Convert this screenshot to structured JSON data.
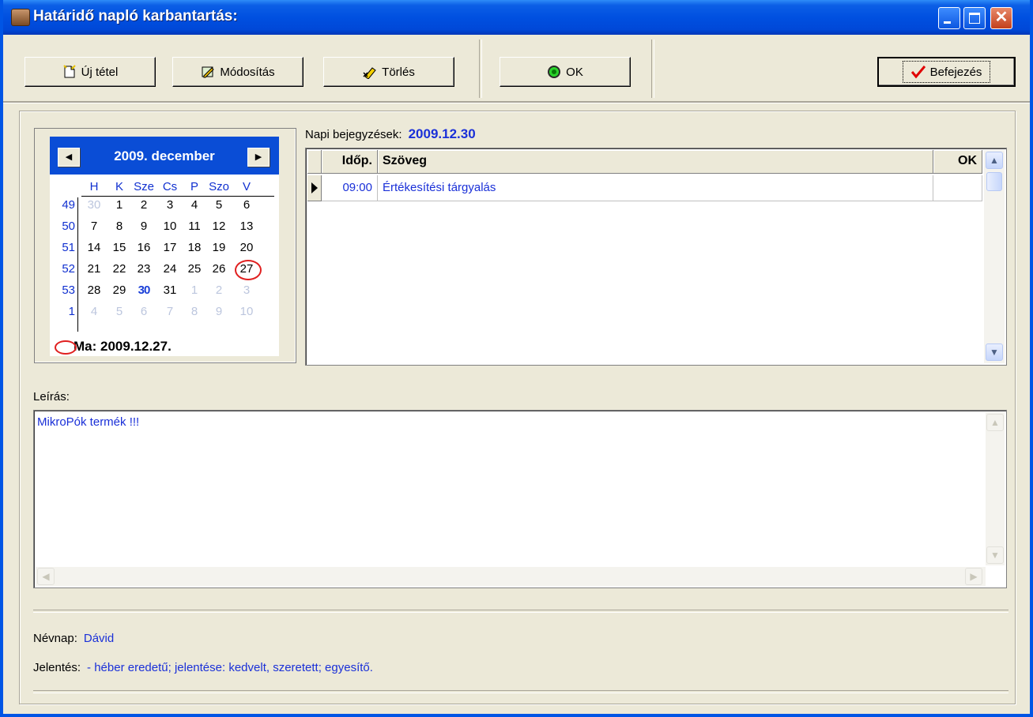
{
  "window": {
    "title": "Határidő napló karbantartás:"
  },
  "toolbar": {
    "new_label": "Új tétel",
    "modify_label": "Módosítás",
    "delete_label": "Törlés",
    "ok_label": "OK",
    "finish_label": "Befejezés"
  },
  "calendar": {
    "month_label": "2009. december",
    "prev_label": "◀",
    "next_label": "▶",
    "day_names": [
      "H",
      "K",
      "Sze",
      "Cs",
      "P",
      "Szo",
      "V"
    ],
    "weeks": [
      {
        "num": "49",
        "days": [
          "30",
          "1",
          "2",
          "3",
          "4",
          "5",
          "6"
        ]
      },
      {
        "num": "50",
        "days": [
          "7",
          "8",
          "9",
          "10",
          "11",
          "12",
          "13"
        ]
      },
      {
        "num": "51",
        "days": [
          "14",
          "15",
          "16",
          "17",
          "18",
          "19",
          "20"
        ]
      },
      {
        "num": "52",
        "days": [
          "21",
          "22",
          "23",
          "24",
          "25",
          "26",
          "27"
        ]
      },
      {
        "num": "53",
        "days": [
          "28",
          "29",
          "30",
          "31",
          "1",
          "2",
          "3"
        ]
      },
      {
        "num": "1",
        "days": [
          "4",
          "5",
          "6",
          "7",
          "8",
          "9",
          "10"
        ]
      }
    ],
    "today_label": "Ma: 2009.12.27.",
    "colors": {
      "header": "#0a4dd6",
      "accent": "#1030d0",
      "today_circle": "#e02020",
      "other_month": "#bcc6de"
    }
  },
  "entries": {
    "caption": "Napi bejegyzések:",
    "date": "2009.12.30",
    "columns": [
      "Időp.",
      "Szöveg",
      "OK"
    ],
    "rows": [
      {
        "time": "09:00",
        "text": "Értékesítési tárgyalás",
        "ok": ""
      }
    ]
  },
  "description": {
    "label": "Leírás:",
    "value": "MikroPók termék !!!"
  },
  "nameday": {
    "label": "Névnap:",
    "value": "Dávid",
    "meaning_label": "Jelentés:",
    "meaning_value": "- héber eredetű; jelentése: kedvelt, szeretett; egyesítő."
  }
}
